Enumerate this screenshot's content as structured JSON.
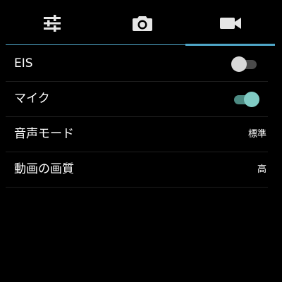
{
  "tabs": [
    {
      "icon": "sliders-icon",
      "active": false
    },
    {
      "icon": "camera-icon",
      "active": false
    },
    {
      "icon": "video-camera-icon",
      "active": true
    }
  ],
  "accent_color": "#4fa6c8",
  "settings": [
    {
      "label": "EIS",
      "type": "toggle",
      "state": "off"
    },
    {
      "label": "マイク",
      "type": "toggle",
      "state": "on"
    },
    {
      "label": "音声モード",
      "type": "value",
      "value": "標準"
    },
    {
      "label": "動画の画質",
      "type": "value",
      "value": "高"
    }
  ]
}
